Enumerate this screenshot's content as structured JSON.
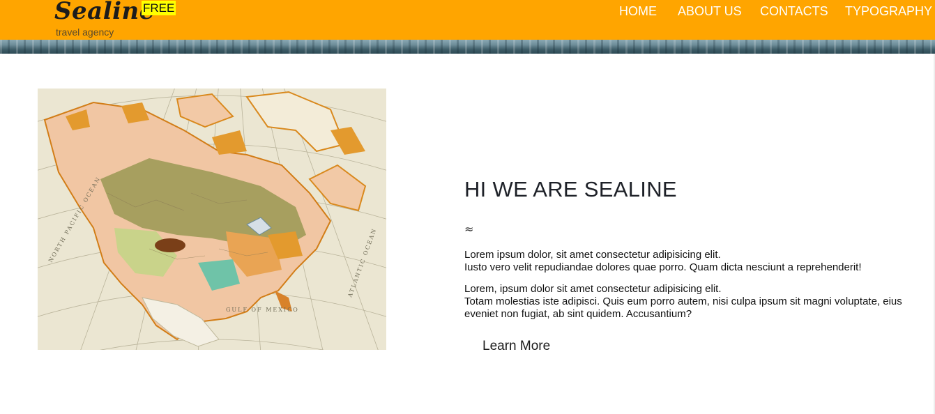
{
  "header": {
    "logo": {
      "name": "Sealine",
      "tagline": "travel agency",
      "badge": "FREE"
    },
    "nav": [
      "HOME",
      "ABOUT US",
      "CONTACTS",
      "TYPOGRAPHY"
    ],
    "background_color": "#ffa500"
  },
  "main": {
    "image_alt_icon": "map-image",
    "headline": "HI WE ARE SEALINE",
    "divider_glyph": "≈",
    "paragraph1": [
      "Lorem ipsum dolor, sit amet consectetur adipisicing elit.",
      "Iusto vero velit repudiandae dolores quae porro. Quam dicta nesciunt a reprehenderit!"
    ],
    "paragraph2": [
      "Lorem, ipsum dolor sit amet consectetur adipisicing elit.",
      "Totam molestias iste adipisci. Quis eum porro autem, nisi culpa ipsum sit magni voluptate, eius",
      "eveniet non fugiat, ab sint quidem. Accusantium?"
    ],
    "cta": "Learn More"
  }
}
